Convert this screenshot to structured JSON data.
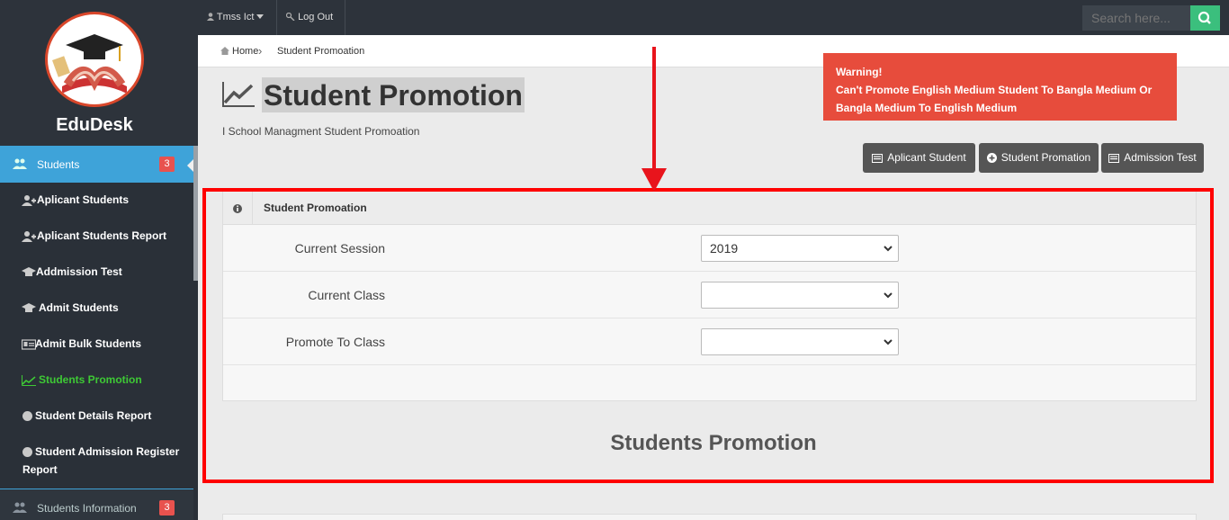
{
  "app": {
    "brand_name": "EduDesk"
  },
  "sidebar": {
    "active": {
      "label": "Students",
      "badge": "3"
    },
    "items": [
      {
        "label": "Aplicant Students",
        "icon": "user-add-icon"
      },
      {
        "label": "Aplicant Students Report",
        "icon": "user-add-icon"
      },
      {
        "label": "Addmission Test",
        "icon": "graduation-cap-icon"
      },
      {
        "label": "Admit Students",
        "icon": "graduation-cap-icon"
      },
      {
        "label": "Admit Bulk Students",
        "icon": "id-card-icon"
      },
      {
        "label": "Students Promotion",
        "icon": "line-chart-icon",
        "active": true
      },
      {
        "label": "Student Details Report",
        "icon": "circle-icon"
      },
      {
        "label": "Student Admission Register",
        "label_line2": "Report",
        "icon": "circle-icon"
      }
    ],
    "bottom": {
      "label": "Students Information",
      "badge": "3"
    }
  },
  "topbar": {
    "user_label": "Tmss Ict",
    "logout_label": "Log Out",
    "search_placeholder": "Search here..."
  },
  "breadcrumb": {
    "home": "Home",
    "current": "Student Promoation"
  },
  "header": {
    "title": "Student Promotion",
    "subtitle": "I School Managment Student Promoation"
  },
  "warning": {
    "title": "Warning!",
    "message": "Can't Promote English Medium Student To Bangla Medium Or Bangla Medium To English Medium"
  },
  "actions": {
    "applicant": "Aplicant Student",
    "promotion": "Student Promation",
    "admission": "Admission Test"
  },
  "panel": {
    "title": "Student Promoation",
    "fields": [
      {
        "label": "Current Session",
        "value": "2019"
      },
      {
        "label": "Current Class",
        "value": ""
      },
      {
        "label": "Promote To Class",
        "value": ""
      }
    ]
  },
  "section_heading": "Students Promotion",
  "colors": {
    "accent": "#3ea3d9",
    "warning": "#e74c3c",
    "active_green": "#3ec935",
    "search_button": "#3bbf7d"
  }
}
